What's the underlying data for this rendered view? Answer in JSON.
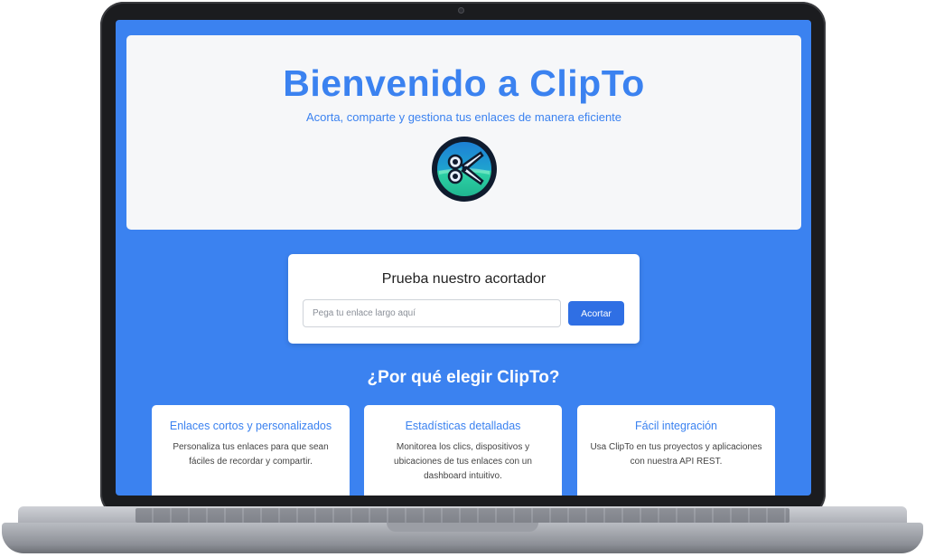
{
  "hero": {
    "title": "Bienvenido a ClipTo",
    "subtitle": "Acorta, comparte y gestiona tus enlaces de manera eficiente",
    "logo_icon": "scissors-icon"
  },
  "shortener": {
    "heading": "Prueba nuestro acortador",
    "input_placeholder": "Pega tu enlace largo aquí",
    "input_value": "",
    "button_label": "Acortar"
  },
  "features": {
    "heading": "¿Por qué elegir ClipTo?",
    "cards": [
      {
        "title": "Enlaces cortos y personalizados",
        "description": "Personaliza tus enlaces para que sean fáciles de recordar y compartir."
      },
      {
        "title": "Estadísticas detalladas",
        "description": "Monitorea los clics, dispositivos y ubicaciones de tus enlaces con un dashboard intuitivo."
      },
      {
        "title": "Fácil integración",
        "description": "Usa ClipTo en tus proyectos y aplicaciones con nuestra API REST."
      }
    ]
  },
  "colors": {
    "primary": "#3b82f0",
    "button": "#2f6fe4",
    "panel": "#f6f7f9"
  }
}
